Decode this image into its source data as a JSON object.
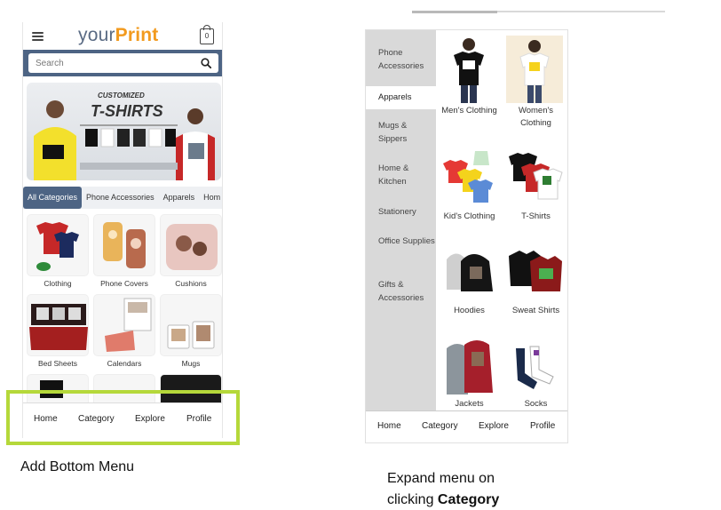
{
  "left_phone": {
    "logo_part1": "your",
    "logo_part2": "Print",
    "cart_count": "0",
    "search_placeholder": "Search",
    "banner_line1": "CUSTOMIZED",
    "banner_line2": "T-SHIRTS",
    "category_tabs": [
      "All Categories",
      "Phone Accessories",
      "Apparels",
      "Hom"
    ],
    "tiles": [
      "Clothing",
      "Phone Covers",
      "Cushions",
      "Bed Sheets",
      "Calendars",
      "Mugs"
    ],
    "bottom_nav": [
      "Home",
      "Category",
      "Explore",
      "Profile"
    ]
  },
  "right_phone": {
    "side_menu": [
      "Phone Accessories",
      "Apparels",
      "Mugs & Sippers",
      "Home & Kitchen",
      "Stationery",
      "Office Supplies",
      "Gifts & Accessories"
    ],
    "active_item": "Apparels",
    "products": [
      "Men's Clothing",
      "Women's Clothing",
      "Kid's Clothing",
      "T-Shirts",
      "Hoodies",
      "Sweat Shirts",
      "Jackets",
      "Socks"
    ],
    "bottom_nav": [
      "Home",
      "Category",
      "Explore",
      "Profile"
    ]
  },
  "captions": {
    "left": "Add Bottom Menu",
    "right_line1": "Expand menu on",
    "right_line2_prefix": "clicking ",
    "right_line2_bold": "Category"
  },
  "colors": {
    "brand_blue": "#4d6484",
    "brand_orange": "#f29a1e",
    "highlight_green": "#b5d83a",
    "side_menu_grey": "#d9d9d9"
  }
}
